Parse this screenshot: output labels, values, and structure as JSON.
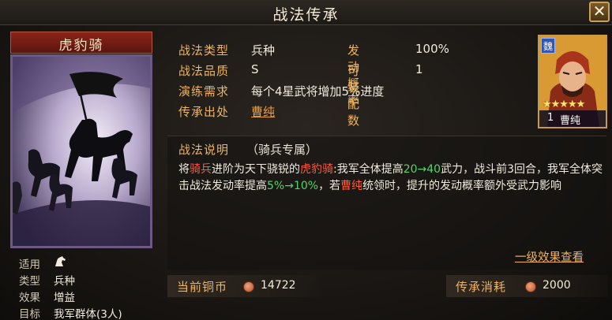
{
  "window": {
    "title": "战法传承",
    "close_label": "✕"
  },
  "card": {
    "name": "虎豹骑",
    "attributes": [
      {
        "key": "适用",
        "value": "",
        "icon": "horse-icon"
      },
      {
        "key": "类型",
        "value": "兵种"
      },
      {
        "key": "效果",
        "value": "增益"
      },
      {
        "key": "目标",
        "value": "我军群体(3人)"
      }
    ]
  },
  "info": {
    "type_label": "战法类型",
    "type_value": "兵种",
    "quality_label": "战法品质",
    "quality_value": "S",
    "practice_label": "演练需求",
    "practice_value": "每个4星武将增加5%进度",
    "origin_label": "传承出处",
    "origin_value": "曹纯",
    "rate_label": "发动概率",
    "rate_value": "100%",
    "equip_label": "可装配数",
    "equip_value": "1"
  },
  "portrait": {
    "faction": "魏",
    "stars": "★★★★★",
    "level": "1",
    "name": "曹纯"
  },
  "description": {
    "label": "战法说明",
    "tag": "（骑兵专属）",
    "t1": "将",
    "t2": "骑兵",
    "t3": "进阶为天下骁锐的",
    "t4": "虎豹骑",
    "t5": ":我军全体提高",
    "t6": "20→40",
    "t7": "武力，战斗前3回合，",
    "t8": "我军全体突击战法发动率提高",
    "t9": "5%→10%",
    "t10": "，若",
    "t11": "曹纯",
    "t12": "统领时，提升的发动概率额外受武力影响",
    "first_effect_link": "一级效果查看"
  },
  "footer": {
    "coin_label": "当前铜币",
    "coin_value": "14722",
    "cost_label": "传承消耗",
    "cost_value": "2000"
  },
  "colors": {
    "accent": "#f0b45c",
    "highlight_red": "#ff5a3c",
    "highlight_green": "#55d46a"
  }
}
